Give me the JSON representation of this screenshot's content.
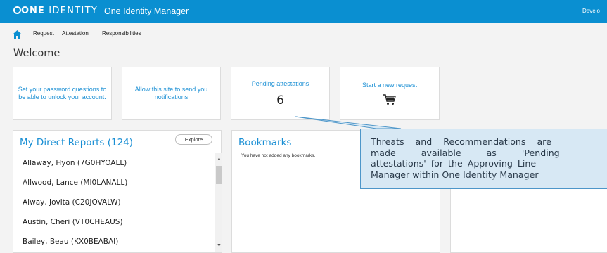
{
  "header": {
    "logo_one": "ONE",
    "logo_identity": "IDENTITY",
    "product": "One Identity Manager",
    "user_menu": "Develo"
  },
  "nav": {
    "home_icon": "home-icon",
    "items": [
      "Request",
      "Attestation",
      "Responsibilities"
    ]
  },
  "page_title": "Welcome",
  "tiles": [
    {
      "text": "Set your password questions to be able to unlock your account."
    },
    {
      "text": "Allow this site to send you notifications"
    },
    {
      "text": "Pending attestations",
      "count": "6"
    },
    {
      "text": "Start a new request",
      "icon": "shopping-cart-icon"
    }
  ],
  "direct_reports": {
    "title": "My Direct Reports (124)",
    "explore": "Explore",
    "rows": [
      "Allaway, Hyon (7G0HYOALL)",
      "Allwood, Lance (MI0LANALL)",
      "Alway, Jovita (C20JOVALW)",
      "Austin, Cheri (VT0CHEAUS)",
      "Bailey, Beau (KX0BEABAI)"
    ]
  },
  "bookmarks": {
    "title": "Bookmarks",
    "empty": "You have not added any bookmarks."
  },
  "callout": {
    "lines": [
      "Threats and Recommendations are",
      "made available as 'Pending",
      "attestations' for the Approving Line",
      "Manager within One Identity Manager"
    ]
  },
  "colors": {
    "brand_blue": "#0a8fd1",
    "link_blue": "#1a8fd4",
    "callout_fill": "#d7e8f4",
    "callout_border": "#4d96c9"
  }
}
